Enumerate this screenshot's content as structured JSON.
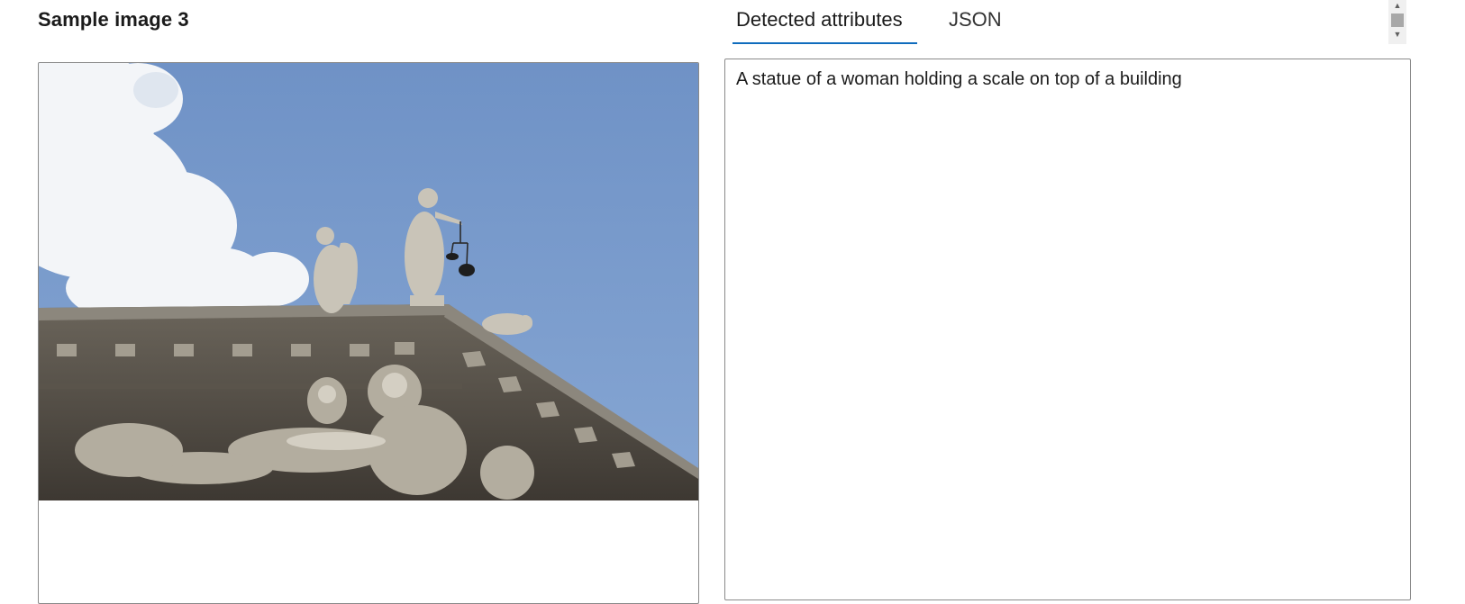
{
  "left_panel": {
    "title": "Sample image 3",
    "image": {
      "description": "statue-on-building-photo",
      "colors": {
        "sky": "#7c9dcd",
        "cloud": "#f4f6f8",
        "stone": "#8a8478",
        "stone_dark": "#3f3a33"
      }
    }
  },
  "tabs": [
    {
      "label": "Detected attributes",
      "selected": true
    },
    {
      "label": "JSON",
      "selected": false
    }
  ],
  "result": {
    "caption": "A statue of a woman holding a scale on top of a building"
  },
  "scrollbar": {
    "up_icon": "scroll-up-arrow-icon",
    "down_icon": "scroll-down-arrow-icon"
  },
  "colors": {
    "accent": "#0f6cbd",
    "border": "#8a8a8a",
    "text": "#1b1b1b"
  }
}
